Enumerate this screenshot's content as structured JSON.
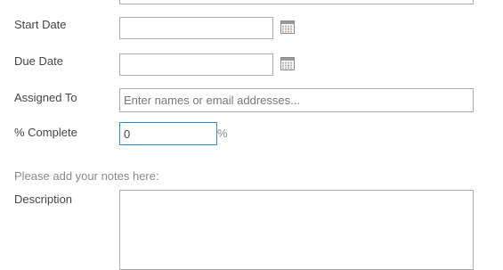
{
  "form": {
    "start_date": {
      "label": "Start Date",
      "value": ""
    },
    "due_date": {
      "label": "Due Date",
      "value": ""
    },
    "assigned_to": {
      "label": "Assigned To",
      "placeholder": "Enter names or email addresses...",
      "value": ""
    },
    "percent_complete": {
      "label": "% Complete",
      "value": "0",
      "unit": "%"
    },
    "notes_hint": "Please add your notes here:",
    "description": {
      "label": "Description",
      "value": ""
    }
  },
  "icons": {
    "calendar": "calendar-icon"
  },
  "colors": {
    "focus_border": "#2a8dd4",
    "field_border": "#ababab",
    "label_text": "#444444",
    "hint_text": "#8a8a8a"
  }
}
